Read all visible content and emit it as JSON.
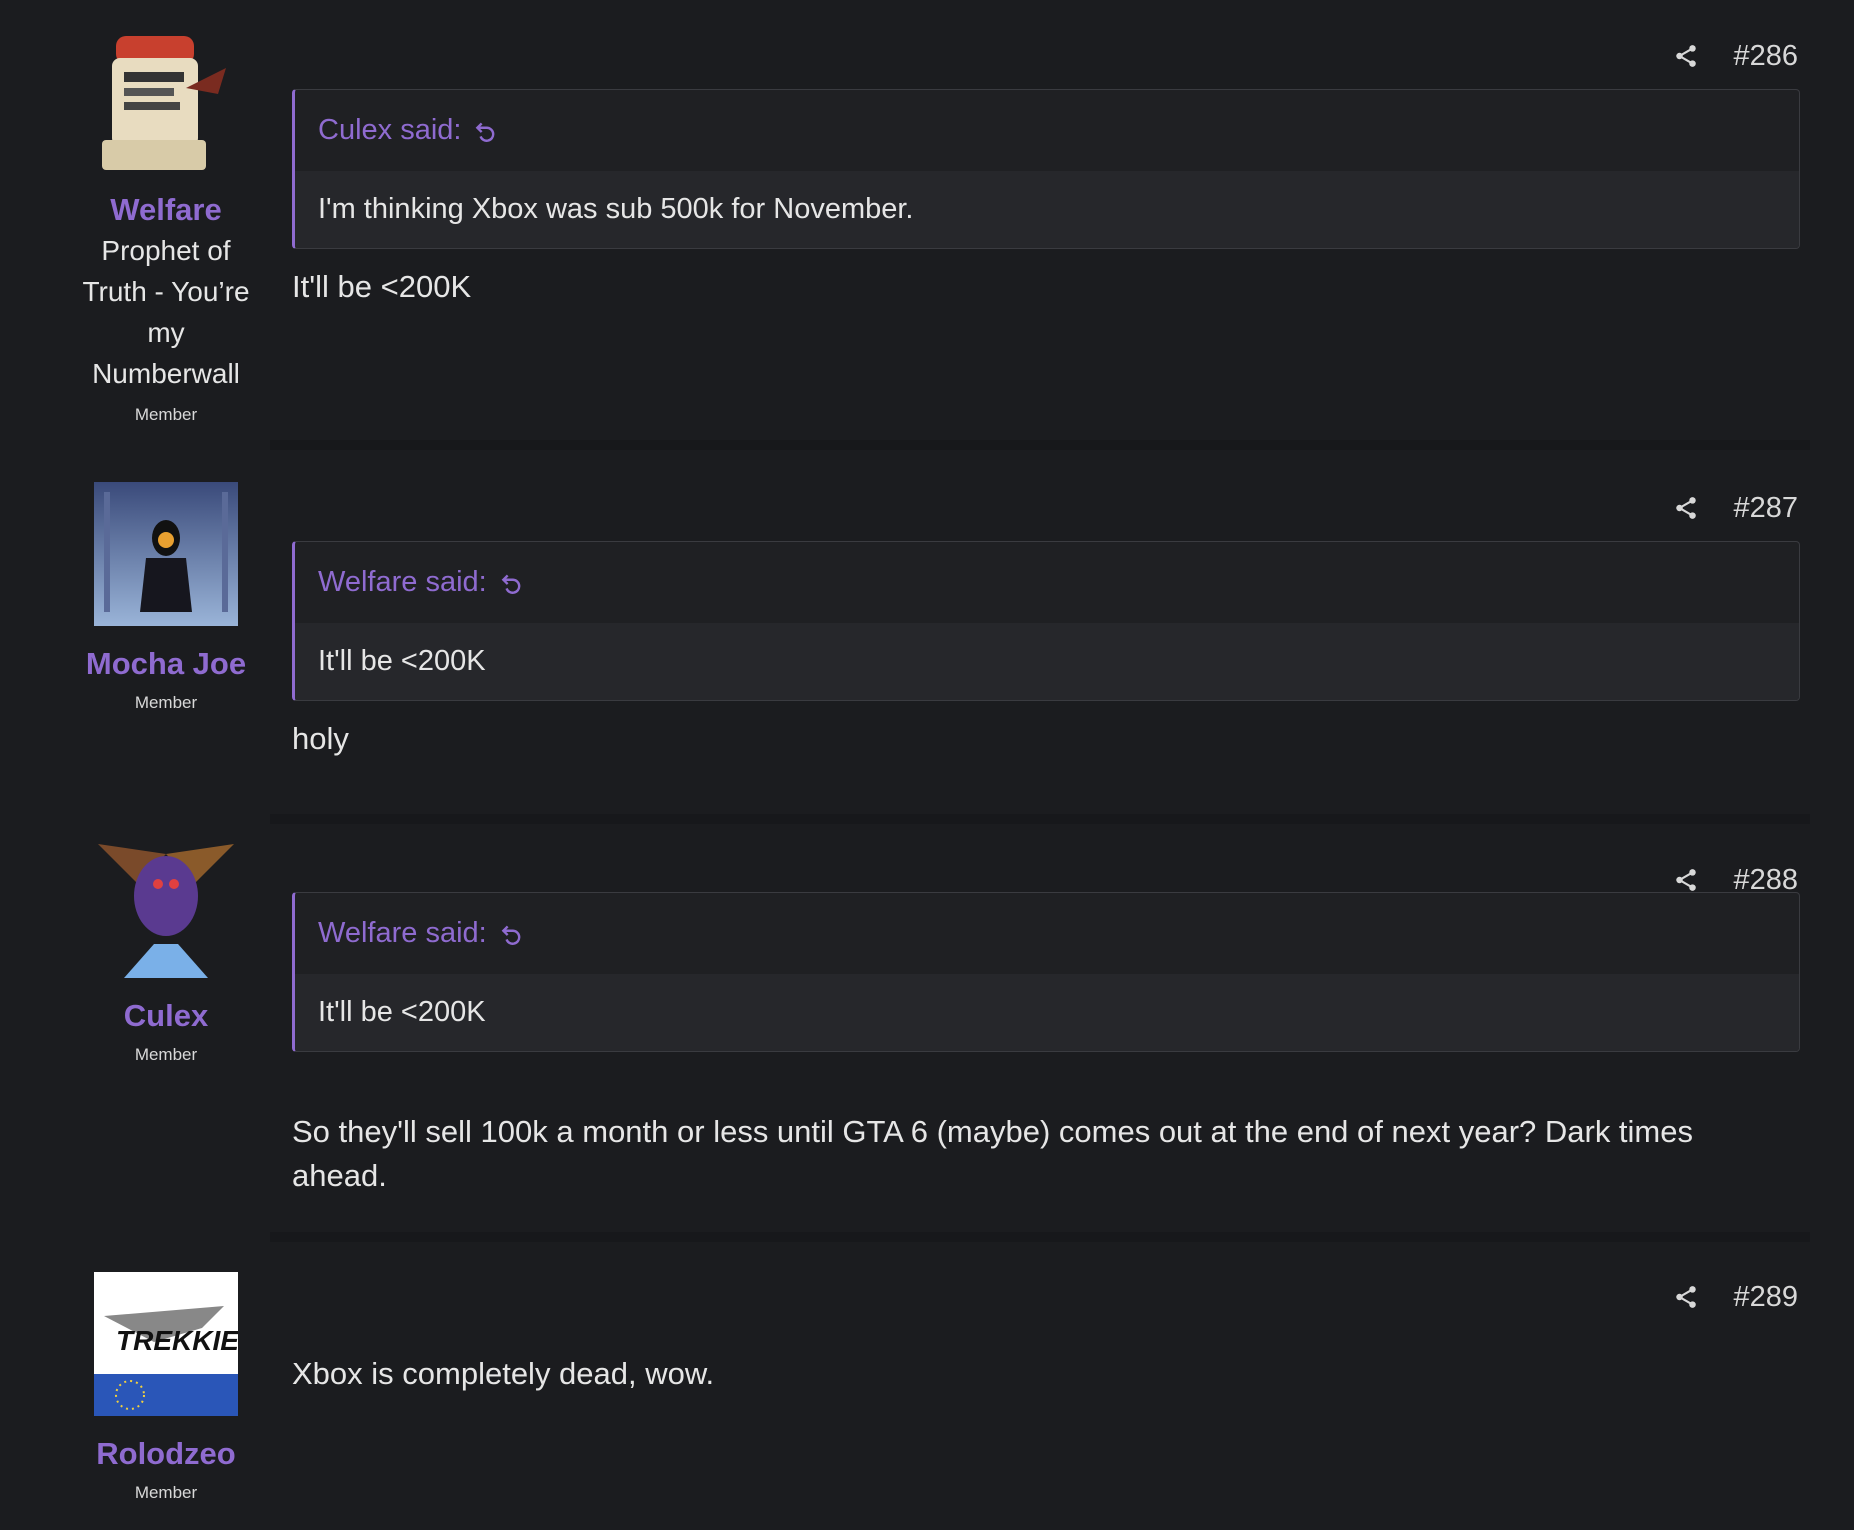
{
  "posts": [
    {
      "number": "#286",
      "user": {
        "name": "Welfare",
        "title_lines": [
          "Prophet of",
          "Truth - You’re",
          "my",
          "Numberwall"
        ],
        "role": "Member"
      },
      "quote": {
        "author": "Culex said:",
        "text": "I'm thinking Xbox was sub 500k for November."
      },
      "message": "It'll be <200K"
    },
    {
      "number": "#287",
      "user": {
        "name": "Mocha Joe",
        "role": "Member"
      },
      "quote": {
        "author": "Welfare said:",
        "text": "It'll be <200K"
      },
      "message": "holy"
    },
    {
      "number": "#288",
      "user": {
        "name": "Culex",
        "role": "Member"
      },
      "quote": {
        "author": "Welfare said:",
        "text": "It'll be <200K"
      },
      "message": "So they'll sell 100k a month or less until GTA 6 (maybe) comes out at the end of next year? Dark times ahead."
    },
    {
      "number": "#289",
      "user": {
        "name": "Rolodzeo",
        "role": "Member",
        "avatar_text": "TREKKIE"
      },
      "message": "Xbox is completely dead, wow."
    }
  ],
  "colors": {
    "accent": "#8f6bd0",
    "background": "#1b1c1f",
    "quote_body": "#26272b"
  },
  "icons": {
    "share": "share-icon",
    "reply": "reply-arrow-icon"
  }
}
